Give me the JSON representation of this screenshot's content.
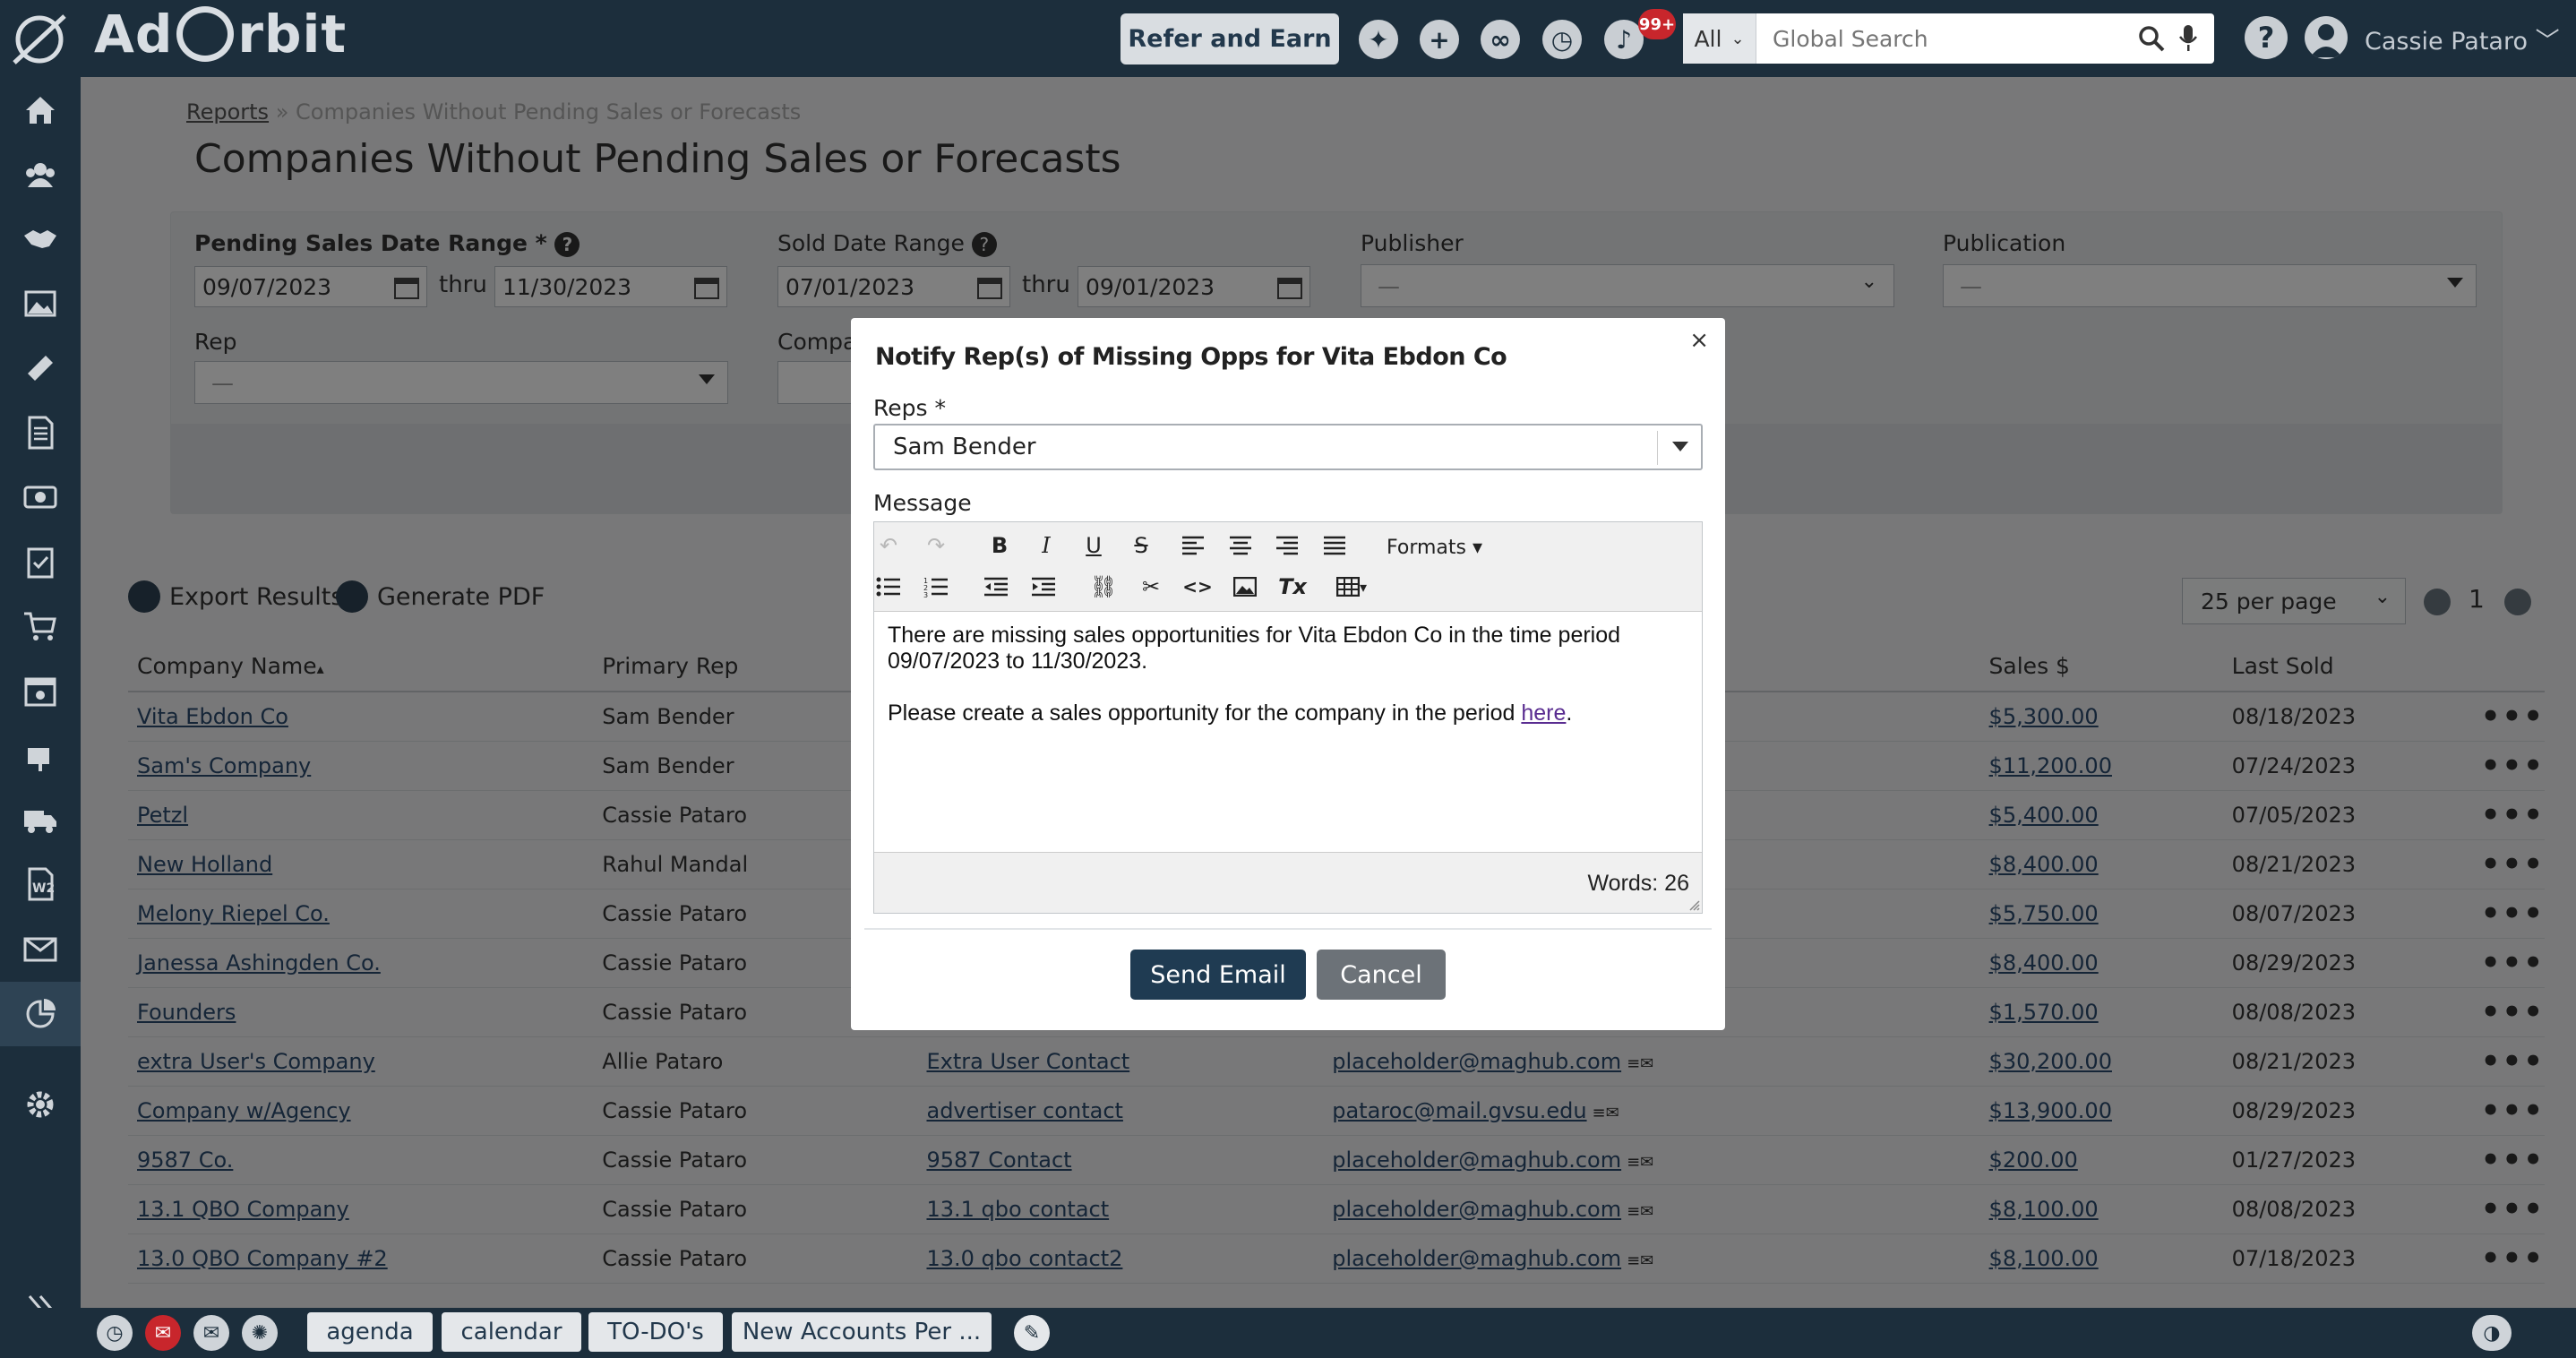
{
  "app": {
    "brand_prefix": "Ad",
    "brand_suffix": "rbit",
    "refer_label": "Refer and Earn",
    "notification_count": "99+",
    "search_scope": "All",
    "search_placeholder": "Global Search",
    "help_label": "?",
    "user_name": "Cassie Pataro"
  },
  "breadcrumb": {
    "root": "Reports",
    "separator": "»",
    "current": "Companies Without Pending Sales or Forecasts"
  },
  "page_title": "Companies Without Pending Sales or Forecasts",
  "filters": {
    "pending_label": "Pending Sales Date Range *",
    "pending_from": "09/07/2023",
    "pending_to": "11/30/2023",
    "thru": "thru",
    "sold_label": "Sold Date Range",
    "sold_from": "07/01/2023",
    "sold_to": "09/01/2023",
    "publisher_label": "Publisher",
    "publisher_value": "—",
    "publication_label": "Publication",
    "publication_value": "—",
    "rep_label": "Rep",
    "rep_value": "—",
    "company_label": "Compan"
  },
  "actions": {
    "export": "Export Results",
    "pdf": "Generate PDF",
    "per_page": "25 per page",
    "page": "1"
  },
  "table": {
    "headers": [
      "Company Name",
      "Primary Rep",
      "",
      "",
      "Sales $",
      "Last Sold"
    ],
    "sort_indicator": "▴",
    "rows": [
      {
        "company": "Vita Ebdon Co",
        "rep": "Sam Bender",
        "contact": "",
        "email": "",
        "sales": "$5,300.00",
        "last": "08/18/2023"
      },
      {
        "company": "Sam's Company",
        "rep": "Sam Bender",
        "contact": "",
        "email": "",
        "sales": "$11,200.00",
        "last": "07/24/2023"
      },
      {
        "company": "Petzl",
        "rep": "Cassie Pataro",
        "contact": "",
        "email": "",
        "sales": "$5,400.00",
        "last": "07/05/2023"
      },
      {
        "company": "New Holland",
        "rep": "Rahul Mandal",
        "contact": "",
        "email": "",
        "sales": "$8,400.00",
        "last": "08/21/2023"
      },
      {
        "company": "Melony Riepel Co.",
        "rep": "Cassie Pataro",
        "contact": "",
        "email": "",
        "sales": "$5,750.00",
        "last": "08/07/2023"
      },
      {
        "company": "Janessa Ashingden Co.",
        "rep": "Cassie Pataro",
        "contact": "",
        "email": "",
        "sales": "$8,400.00",
        "last": "08/29/2023"
      },
      {
        "company": "Founders",
        "rep": "Cassie Pataro",
        "contact": "",
        "email": "",
        "sales": "$1,570.00",
        "last": "08/08/2023"
      },
      {
        "company": "extra User's Company",
        "rep": "Allie Pataro",
        "contact": "Extra User Contact",
        "email": "placeholder@maghub.com",
        "sales": "$30,200.00",
        "last": "08/21/2023"
      },
      {
        "company": "Company w/Agency",
        "rep": "Cassie Pataro",
        "contact": "advertiser contact",
        "email": "pataroc@mail.gvsu.edu",
        "sales": "$13,900.00",
        "last": "08/29/2023"
      },
      {
        "company": "9587 Co.",
        "rep": "Cassie Pataro",
        "contact": "9587 Contact",
        "email": "placeholder@maghub.com",
        "sales": "$200.00",
        "last": "01/27/2023"
      },
      {
        "company": "13.1 QBO Company",
        "rep": "Cassie Pataro",
        "contact": "13.1 qbo contact",
        "email": "placeholder@maghub.com",
        "sales": "$8,100.00",
        "last": "08/08/2023"
      },
      {
        "company": "13.0 QBO Company #2",
        "rep": "Cassie Pataro",
        "contact": "13.0 qbo contact2",
        "email": "placeholder@maghub.com",
        "sales": "$8,100.00",
        "last": "07/18/2023"
      }
    ],
    "row_menu": "•••"
  },
  "modal": {
    "close": "×",
    "title": "Notify Rep(s) of Missing Opps for Vita Ebdon Co",
    "reps_label": "Reps *",
    "reps_value": "Sam Bender",
    "message_label": "Message",
    "formats_label": "Formats",
    "body_line1": "There are missing sales opportunities for Vita Ebdon Co in the time period 09/07/2023 to 11/30/2023.",
    "body_line2_prefix": "Please create a sales opportunity for the company in the period ",
    "body_link": "here",
    "body_line2_suffix": ".",
    "word_count": "Words: 26",
    "send_label": "Send Email",
    "cancel_label": "Cancel"
  },
  "bottom_tabs": [
    "agenda",
    "calendar",
    "TO-DO's",
    "New Accounts Per ..."
  ],
  "colors": {
    "nav": "#1c2e3c",
    "primary_button": "#1f3b52",
    "link": "#2b4a6f",
    "badge": "#c8262c"
  }
}
